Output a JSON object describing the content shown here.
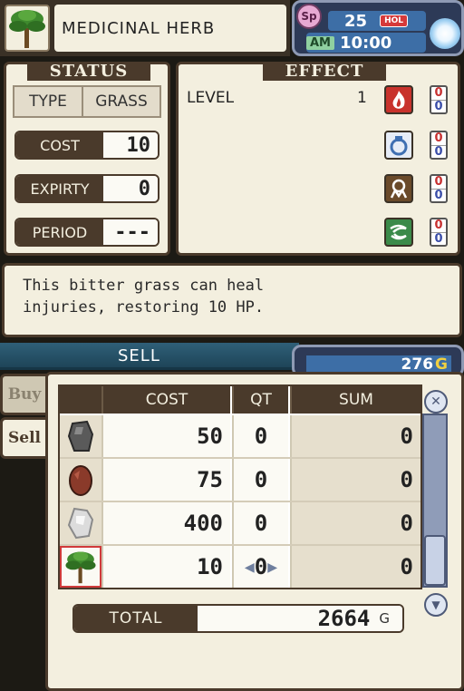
{
  "item": {
    "name": "MEDICINAL HERB",
    "icon": "herb-icon"
  },
  "clock": {
    "sp_label": "Sp",
    "day": "25",
    "holiday_badge": "HOL",
    "ampm": "AM",
    "time": "10:00",
    "weather_icon": "sun-icon"
  },
  "status": {
    "title": "STATUS",
    "type_label": "TYPE",
    "type_value": "GRASS",
    "cost_label": "COST",
    "cost_value": "10",
    "expiry_label": "EXPIRTY",
    "expiry_value": "0",
    "period_label": "PERIOD",
    "period_value": "---"
  },
  "effect": {
    "title": "EFFECT",
    "level_label": "LEVEL",
    "level_value": "1",
    "elements": [
      {
        "name": "fire-icon",
        "color": "#c8322c",
        "top": "0",
        "bottom": "0"
      },
      {
        "name": "water-icon",
        "color": "#3f6fb2",
        "top": "0",
        "bottom": "0"
      },
      {
        "name": "earth-icon",
        "color": "#6a4a2a",
        "top": "0",
        "bottom": "0"
      },
      {
        "name": "wind-icon",
        "color": "#3b8a4a",
        "top": "0",
        "bottom": "0"
      }
    ]
  },
  "description": {
    "line1": "This bitter grass can heal",
    "line2": "injuries, restoring 10 HP."
  },
  "shop": {
    "mode_label": "SELL",
    "gold_value": "276",
    "gold_unit": "G",
    "tabs": {
      "buy": "Buy",
      "sell": "Sell"
    },
    "headers": {
      "cost": "COST",
      "qt": "QT",
      "sum": "SUM"
    },
    "rows": [
      {
        "icon": "gray-ore-icon",
        "cost": "50",
        "qt": "0",
        "sum": "0"
      },
      {
        "icon": "red-ore-icon",
        "cost": "75",
        "qt": "0",
        "sum": "0"
      },
      {
        "icon": "white-ore-icon",
        "cost": "400",
        "qt": "0",
        "sum": "0"
      },
      {
        "icon": "herb-icon",
        "cost": "10",
        "qt": "0",
        "sum": "0"
      }
    ],
    "total_label": "TOTAL",
    "total_value": "2664",
    "total_unit": "G"
  },
  "colors": {
    "panel": "#f3efdf",
    "frame": "#4a3a2b",
    "accent_blue": "#3d6ea6",
    "gold": "#f0d040"
  }
}
